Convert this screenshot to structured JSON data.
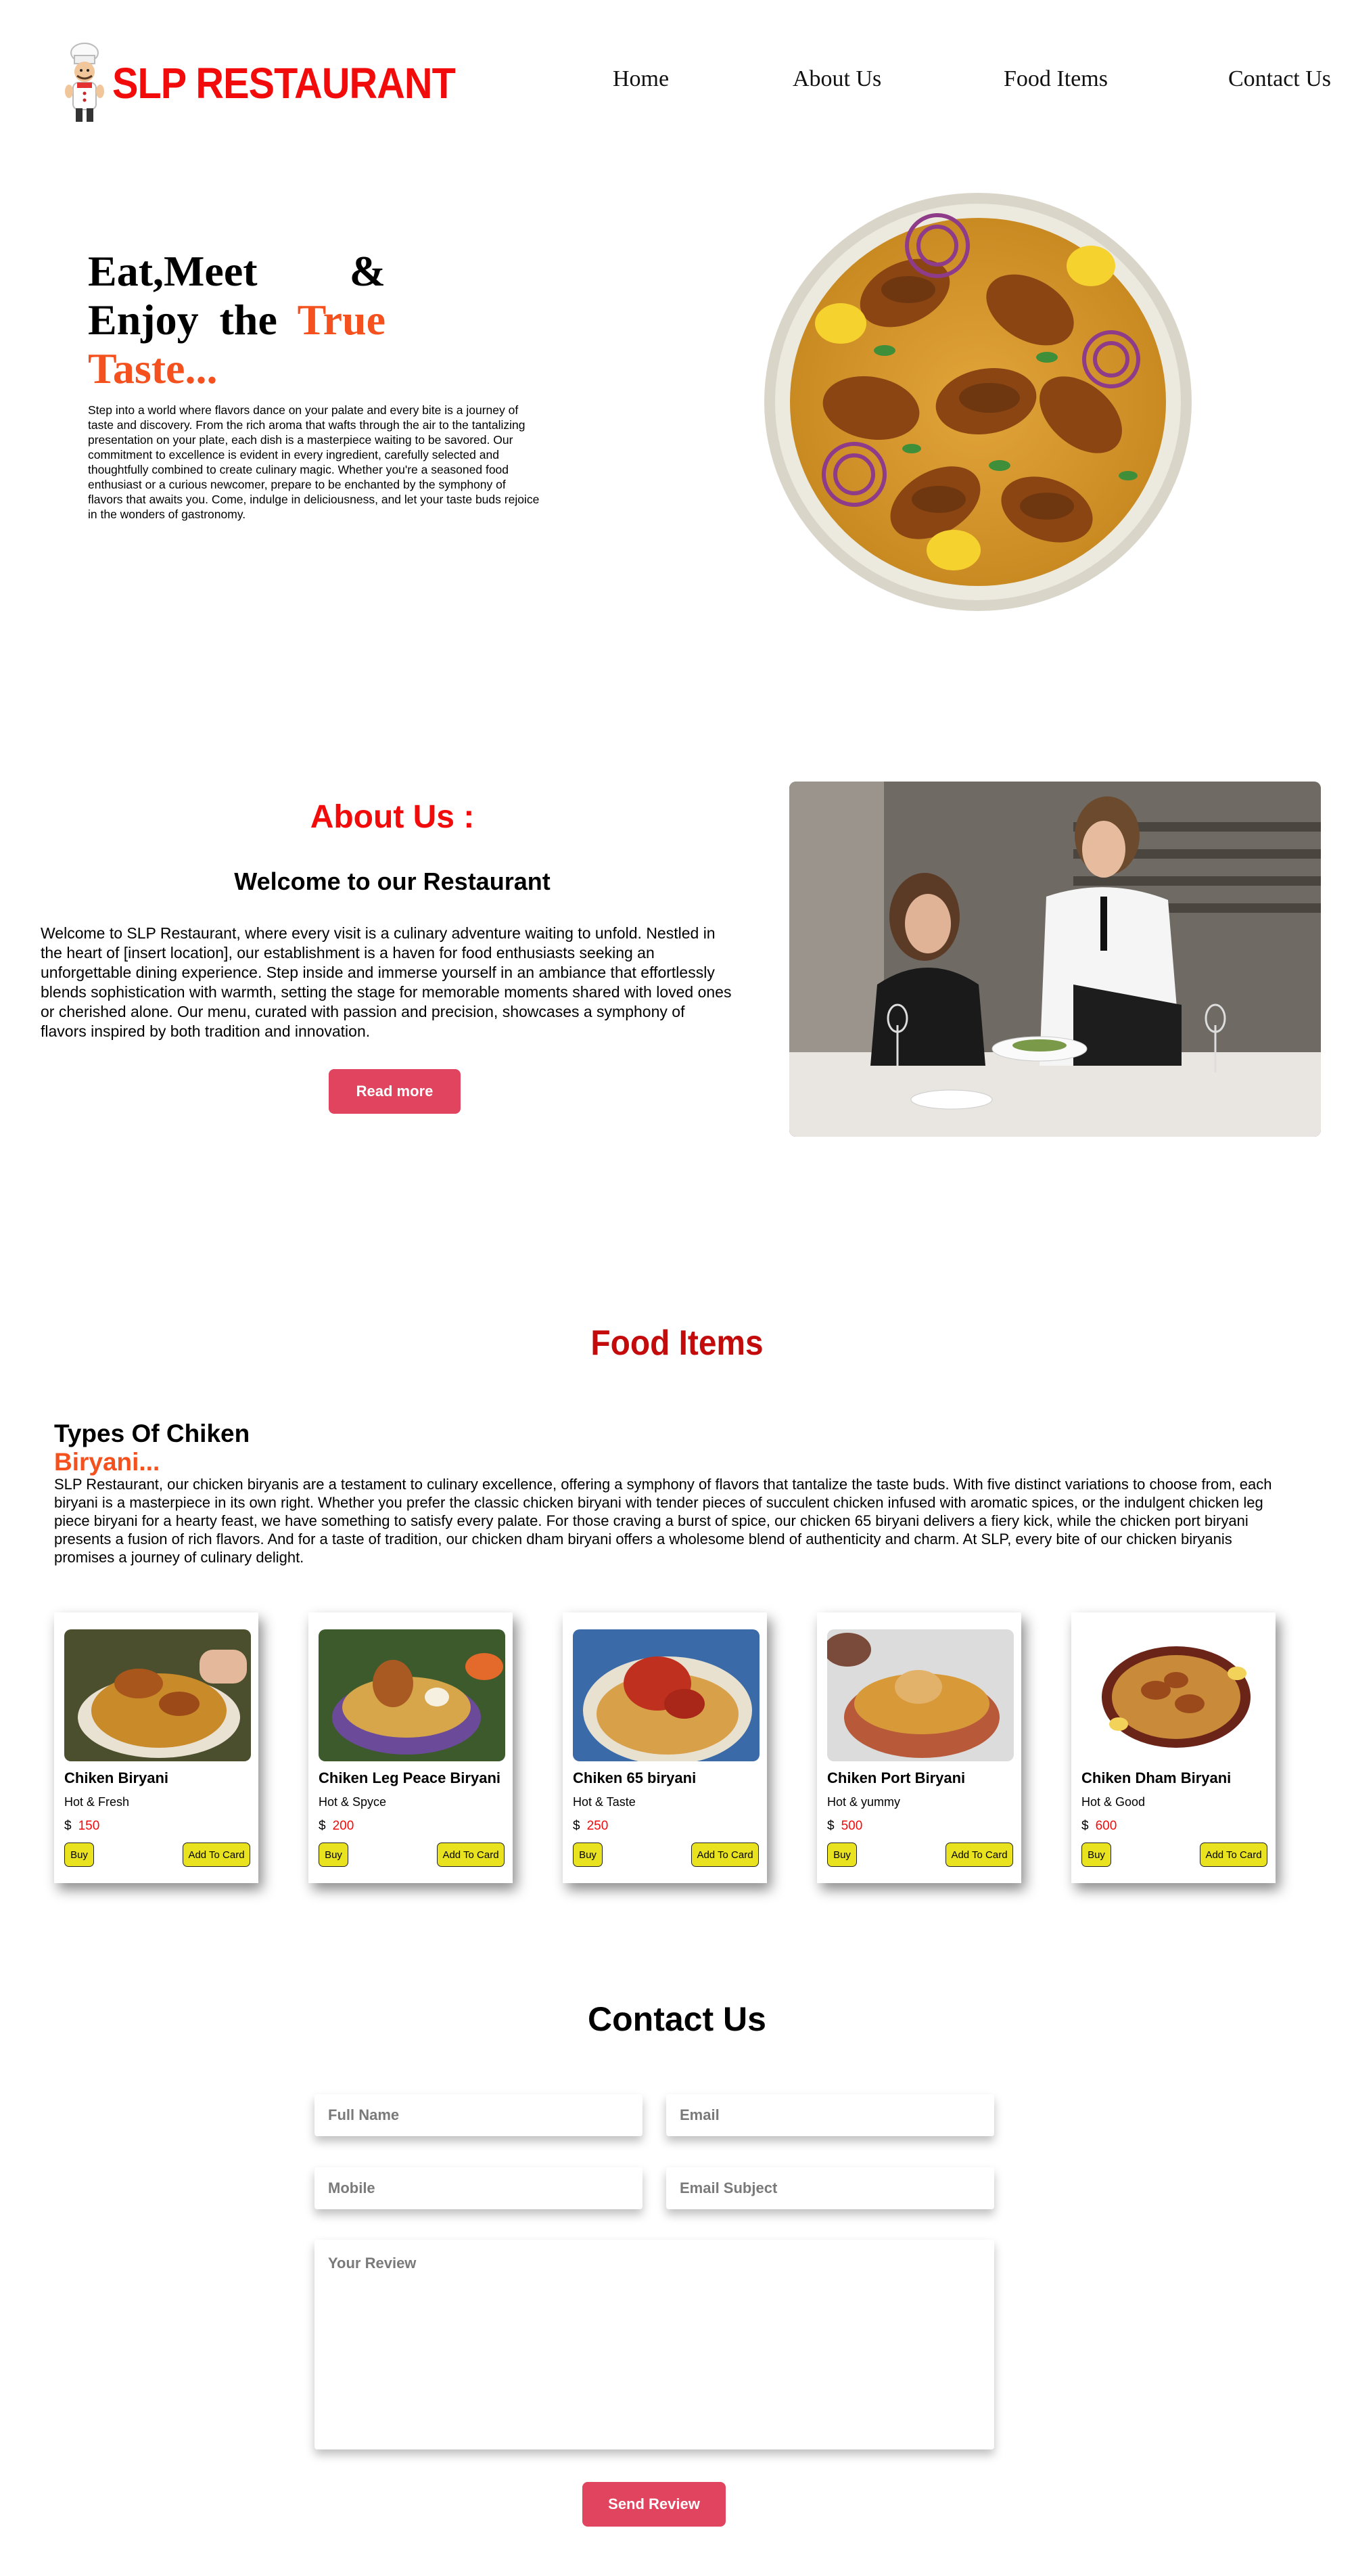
{
  "header": {
    "brand": "SLP RESTAURANT",
    "nav": [
      "Home",
      "About Us",
      "Food Items",
      "Contact Us"
    ]
  },
  "hero": {
    "title_line1": "Eat,Meet  &",
    "title_line2_a": "Enjoy  the ",
    "title_line2_b": "True",
    "title_line3": "Taste...",
    "text": "Step into a world where flavors dance on your palate and every bite is a journey of taste and discovery. From the rich aroma that wafts through the air to the tantalizing presentation on your plate, each dish is a masterpiece waiting to be savored. Our commitment to excellence is evident in every ingredient, carefully selected and thoughtfully combined to create culinary magic. Whether you're a seasoned food enthusiast or a curious newcomer, prepare to be enchanted by the symphony of flavors that awaits you. Come, indulge in deliciousness, and let your taste buds rejoice in the wonders of gastronomy."
  },
  "about": {
    "title": "About Us :",
    "subtitle": "Welcome to our Restaurant",
    "text": "Welcome to SLP Restaurant, where every visit is a culinary adventure waiting to unfold. Nestled in the heart of [insert location], our establishment is a haven for food enthusiasts seeking an unforgettable dining experience. Step inside and immerse yourself in an ambiance that effortlessly blends sophistication with warmth, setting the stage for memorable moments shared with loved ones or cherished alone. Our menu, curated with passion and precision, showcases a symphony of flavors inspired by both tradition and innovation.",
    "read_more": "Read more"
  },
  "food": {
    "title": "Food Items",
    "types_title_a": "Types Of Chiken",
    "types_title_b": "Biryani...",
    "text": "SLP Restaurant, our chicken biryanis are a testament to culinary excellence, offering a symphony of flavors that tantalize the taste buds. With five distinct variations to choose from, each biryani is a masterpiece in its own right. Whether you prefer the classic chicken biryani with tender pieces of succulent chicken infused with aromatic spices, or the indulgent chicken leg piece biryani for a hearty feast, we have something to satisfy every palate. For those craving a burst of spice, our chicken 65 biryani delivers a fiery kick, while the chicken port biryani presents a fusion of rich flavors. And for a taste of tradition, our chicken dham biryani offers a wholesome blend of authenticity and charm. At SLP, every bite of our chicken biryanis promises a journey of culinary delight.",
    "currency": "$",
    "buy_label": "Buy",
    "add_label": "Add To Card",
    "cards": [
      {
        "name": "Chiken Biryani",
        "desc": "Hot & Fresh",
        "price": "150"
      },
      {
        "name": "Chiken Leg Peace Biryani",
        "desc": "Hot & Spyce",
        "price": "200"
      },
      {
        "name": "Chiken 65 biryani",
        "desc": "Hot & Taste",
        "price": "250"
      },
      {
        "name": "Chiken Port Biryani",
        "desc": "Hot & yummy",
        "price": "500"
      },
      {
        "name": "Chiken Dham Biryani",
        "desc": "Hot & Good",
        "price": "600"
      }
    ]
  },
  "contact": {
    "title": "Contact Us",
    "full_name": "Full Name",
    "email": "Email",
    "mobile": "Mobile",
    "subject": "Email Subject",
    "review": "Your Review",
    "send": "Send Review"
  },
  "colors": {
    "brand_red": "#f20b0b",
    "accent_orange": "#f4511e",
    "button_red": "#e0445e",
    "button_yellow": "#e9e31f"
  }
}
